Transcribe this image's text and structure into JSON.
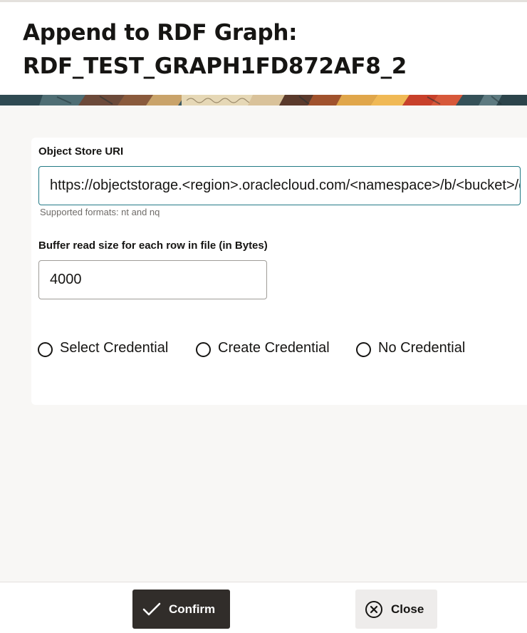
{
  "dialog": {
    "title_line1": "Append to RDF Graph:",
    "title_line2": "RDF_TEST_GRAPH1FD872AF8_2"
  },
  "form": {
    "uri_label": "Object Store URI",
    "uri_value": "https://objectstorage.<region>.oraclecloud.com/<namespace>/b/<bucket>/o/<object>",
    "uri_help": "Supported formats: nt and nq",
    "buffer_label": "Buffer read size for each row in file (in Bytes)",
    "buffer_value": "4000",
    "credential_options": [
      {
        "label": "Select Credential",
        "selected": false
      },
      {
        "label": "Create Credential",
        "selected": false
      },
      {
        "label": "No Credential",
        "selected": false
      }
    ]
  },
  "footer": {
    "confirm_label": "Confirm",
    "confirm_icon": "checkmark-icon",
    "close_label": "Close",
    "close_icon": "circle-x-icon"
  },
  "colors": {
    "primary_button": "#312d2a",
    "secondary_button": "#eeeceb",
    "focus_border": "#237a86",
    "body_background": "#f8f7f5"
  }
}
